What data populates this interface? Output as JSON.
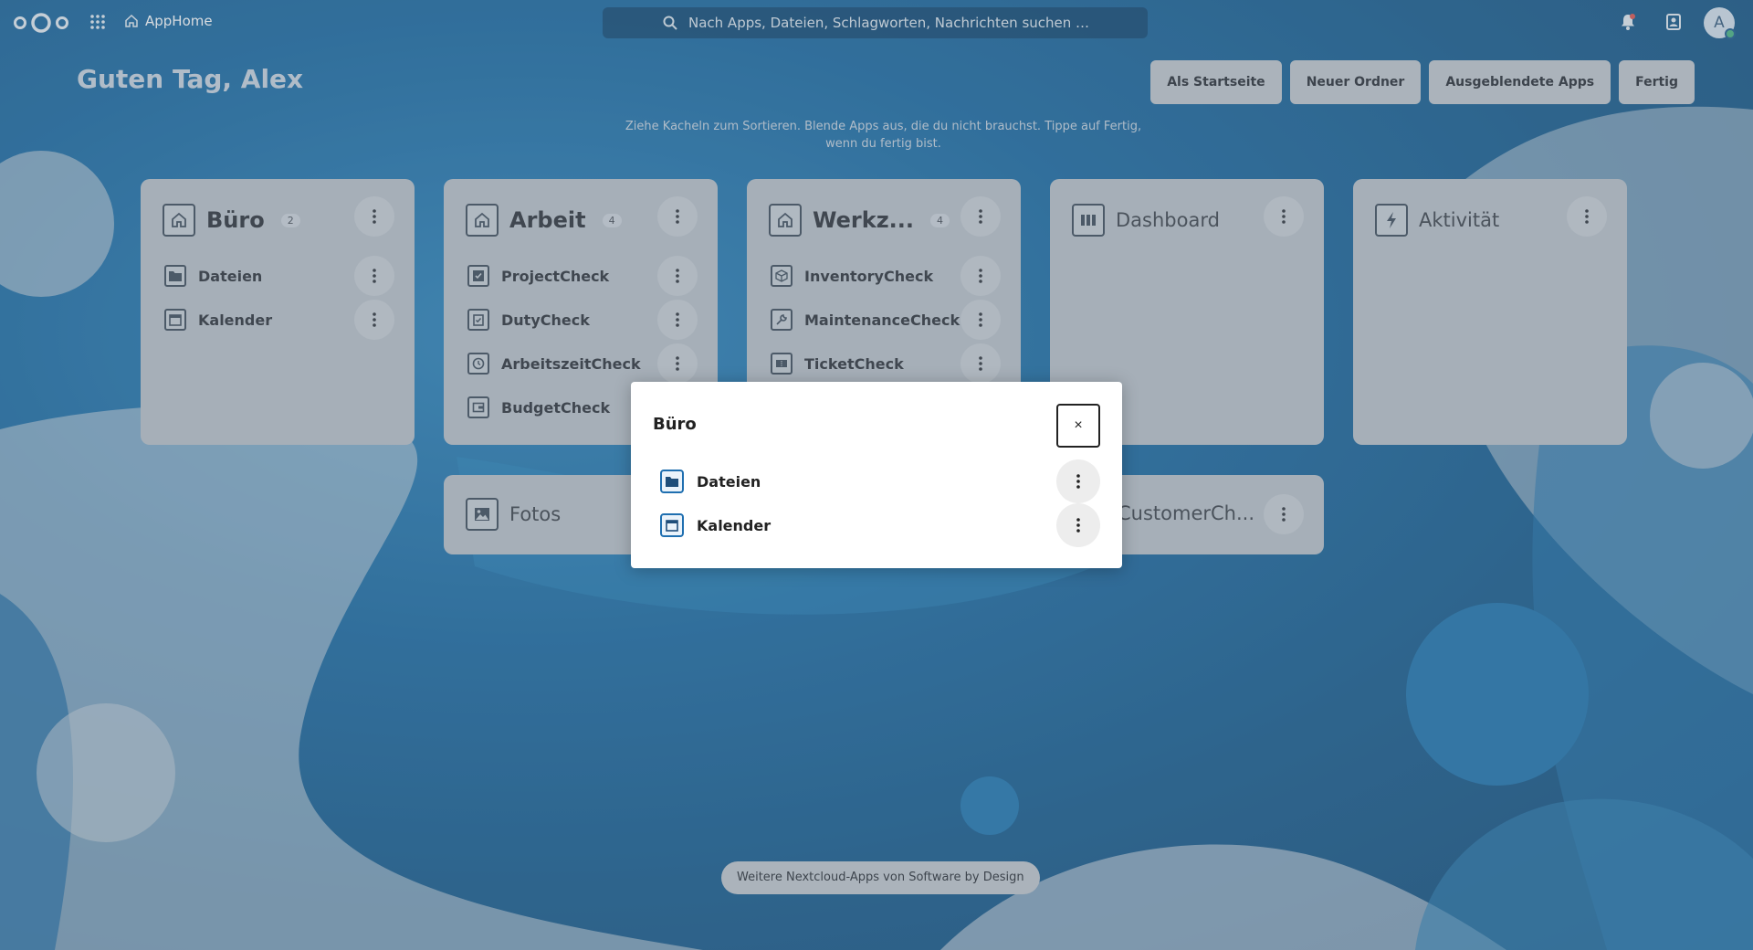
{
  "header": {
    "app_name": "AppHome",
    "search_placeholder": "Nach Apps, Dateien, Schlagworten, Nachrichten suchen …",
    "avatar_initial": "A",
    "icons": [
      "nextcloud-logo",
      "apps-grid-icon",
      "home-icon",
      "search-icon",
      "notifications-icon",
      "contacts-icon"
    ]
  },
  "greeting": "Guten Tag, Alex",
  "toolbar": {
    "set_home": "Als Startseite",
    "new_folder": "Neuer Ordner",
    "hidden_apps": "Ausgeblendete Apps",
    "done": "Fertig"
  },
  "hint": {
    "line1": "Ziehe Kacheln zum Sortieren. Blende Apps aus, die du nicht brauchst. Tippe auf Fertig,",
    "line2": "wenn du fertig bist."
  },
  "tiles": {
    "buero": {
      "title": "Büro",
      "count": "2",
      "apps": [
        "Dateien",
        "Kalender"
      ]
    },
    "arbeit": {
      "title": "Arbeit",
      "count": "4",
      "apps": [
        "ProjectCheck",
        "DutyCheck",
        "ArbeitszeitCheck",
        "BudgetCheck"
      ]
    },
    "werkzeuge": {
      "title": "Werkz...",
      "count": "4",
      "apps": [
        "InventoryCheck",
        "MaintenanceCheck",
        "TicketCheck"
      ]
    },
    "dashboard": {
      "title": "Dashboard"
    },
    "aktivitaet": {
      "title": "Aktivität"
    },
    "fotos": {
      "title": "Fotos"
    },
    "customer": {
      "title": "CustomerCh..."
    }
  },
  "modal": {
    "title": "Büro",
    "close_label": "×",
    "apps": [
      "Dateien",
      "Kalender"
    ]
  },
  "footer": "Weitere Nextcloud-Apps von Software by Design",
  "colors": {
    "tile_bg": "#bcc3ca",
    "accent": "#1f6fb0",
    "background": "#1a6aa2"
  }
}
